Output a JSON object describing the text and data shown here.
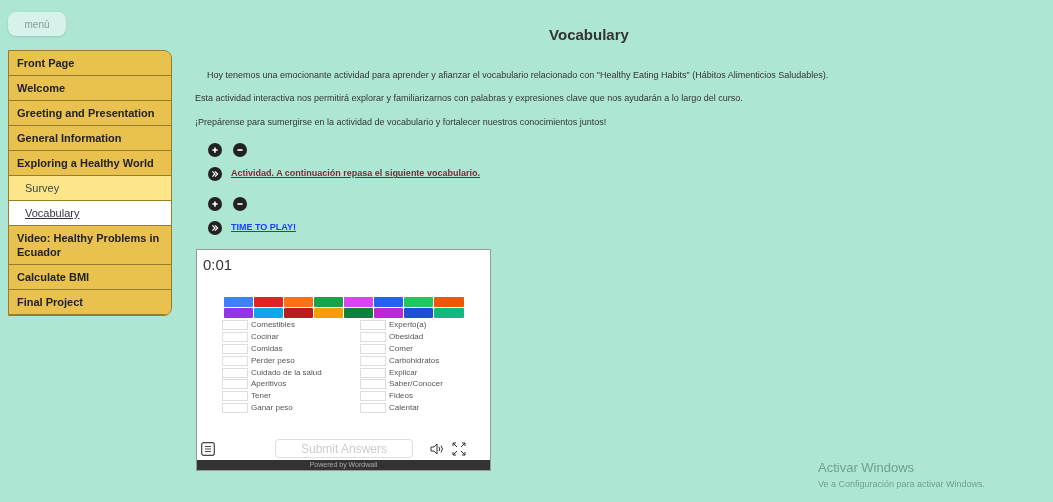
{
  "menu_button": {
    "label": "menú"
  },
  "sidebar": {
    "items": [
      {
        "label": "Front Page",
        "kind": "section",
        "selected": false
      },
      {
        "label": "Welcome",
        "kind": "section",
        "selected": false
      },
      {
        "label": "Greeting and Presentation",
        "kind": "section",
        "selected": false
      },
      {
        "label": "General Information",
        "kind": "section",
        "selected": false
      },
      {
        "label": "Exploring a Healthy World",
        "kind": "section",
        "selected": false
      },
      {
        "label": "Survey",
        "kind": "subpage",
        "selected": false
      },
      {
        "label": "Vocabulary",
        "kind": "subpage",
        "selected": true
      },
      {
        "label": "Video: Healthy Problems in Ecuador",
        "kind": "section",
        "selected": false
      },
      {
        "label": "Calculate BMI",
        "kind": "section",
        "selected": false
      },
      {
        "label": "Final Project",
        "kind": "section",
        "selected": false
      }
    ]
  },
  "page_title": "Vocabulary",
  "paragraphs": [
    "Hoy tenemos una emocionante actividad para aprender y afianzar el vocabulario relacionado con \"Healthy Eating Habits\" (Hábitos Alimenticios Saludables).",
    "Esta actividad interactiva nos permitirá explorar y familiarizarnos con palabras y expresiones clave que nos ayudarán a lo largo del curso.",
    "¡Prepárense para sumergirse en la actividad de vocabulario y fortalecer nuestros conocimientos juntos!"
  ],
  "sections": [
    {
      "link": "Actividad. A continuación repasa el siguiente vocabulario.",
      "kind": "activity"
    },
    {
      "link": "TIME TO PLAY!",
      "kind": "game"
    }
  ],
  "game": {
    "timer": "0:01",
    "tiles": [
      {
        "color": "#3b82f6"
      },
      {
        "color": "#dc2626"
      },
      {
        "color": "#f97316"
      },
      {
        "color": "#16a34a"
      },
      {
        "color": "#d946ef"
      },
      {
        "color": "#2563eb"
      },
      {
        "color": "#22c55e"
      },
      {
        "color": "#ea580c"
      },
      {
        "color": "#9333ea"
      },
      {
        "color": "#0ea5e9"
      },
      {
        "color": "#b91c1c"
      },
      {
        "color": "#f59e0b"
      },
      {
        "color": "#15803d"
      },
      {
        "color": "#c026d3"
      },
      {
        "color": "#1d4ed8"
      },
      {
        "color": "#10b981"
      }
    ],
    "left_words": [
      "Comestibles",
      "Cocinar",
      "Comidas",
      "Perder peso",
      "Cuidado de la salud",
      "Aperitivos",
      "Tener",
      "Ganar peso"
    ],
    "right_words": [
      "Experto(a)",
      "Obesidad",
      "Comer",
      "Carbohidratos",
      "Explicar",
      "Saber/Conocer",
      "Fideos",
      "Calentar"
    ],
    "submit": "Submit Answers",
    "footer": "Powered by Wordwall"
  },
  "os_notice": {
    "title": "Activar Windows",
    "subtitle": "Ve a Configuración para activar Windows."
  }
}
